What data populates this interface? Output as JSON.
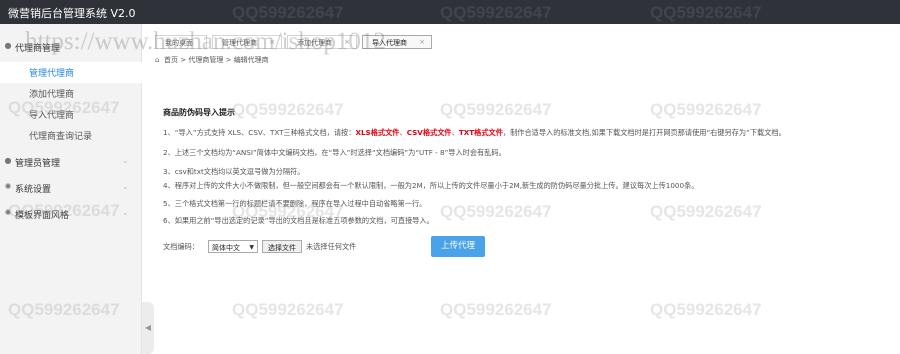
{
  "app": {
    "title": "微营销后台管理系统 V2.0"
  },
  "watermark": {
    "text": "QQ599262647",
    "url": "https://www.huzhan.com/ishop1012"
  },
  "sidebar": {
    "groups": [
      {
        "label": "代理商管理",
        "icon": "person-icon"
      },
      {
        "label": "管理员管理",
        "icon": "person-icon"
      },
      {
        "label": "系统设置",
        "icon": "gear-icon"
      },
      {
        "label": "模板界面风格",
        "icon": "gear-icon"
      }
    ],
    "items": [
      {
        "label": "管理代理商",
        "active": true
      },
      {
        "label": "添加代理商"
      },
      {
        "label": "导入代理商"
      },
      {
        "label": "代理商查询记录"
      }
    ],
    "collapse_icon": "chevron-left-icon"
  },
  "tabs": [
    {
      "label": "我的桌面"
    },
    {
      "label": "管理代理商"
    },
    {
      "label": "添加代理商"
    },
    {
      "label": "导入代理商",
      "active": true
    }
  ],
  "breadcrumb": {
    "home": "首页",
    "sep": ">",
    "level1": "代理商管理",
    "level2": "编辑代理商"
  },
  "main": {
    "title": "商品防伪码导入提示",
    "line1": {
      "a": "1、“导入”方式支持 XLS、CSV、TXT三种格式文档，请按：",
      "xls": "XLS格式文件",
      "b": "、",
      "csv": "CSV格式文件",
      "c": "、",
      "txt": "TXT格式文件",
      "d": "，制作合适导入的标准文档,如果下载文档时是打开网页那请使用“右键另存为”下载文档。"
    },
    "line2": "2、上述三个文档均为“ANSI”简体中文编码文档，在“导入”时选择“文档编码”为“UTF - 8”导入时会有乱码。",
    "line3": "3、csv和txt文档均以英文逗号做为分隔符。",
    "line4": "4、程序对上传的文件大小不做限制，但一般空间都会有一个默认限制，一般为2M，所以上传的文件尽量小于2M,新生成的防伪码尽量分批上传。建议每次上传1000条。",
    "line5": "5、三个格式文档第一行的标题栏请不要删除，程序在导入过程中自动省略第一行。",
    "line6": "6、如果用之前“导出选定的记录”导出的文档且是标准五项参数的文档，可直接导入。"
  },
  "form": {
    "encoding_label": "文档编码：",
    "encoding_value": "简体中文",
    "file_button": "选择文件",
    "file_status": "未选择任何文件",
    "upload_button": "上传代理"
  },
  "colors": {
    "topbar": "#2f3239",
    "accent": "#1e85e0",
    "red": "#e60012",
    "upload": "#4aa3e8"
  }
}
